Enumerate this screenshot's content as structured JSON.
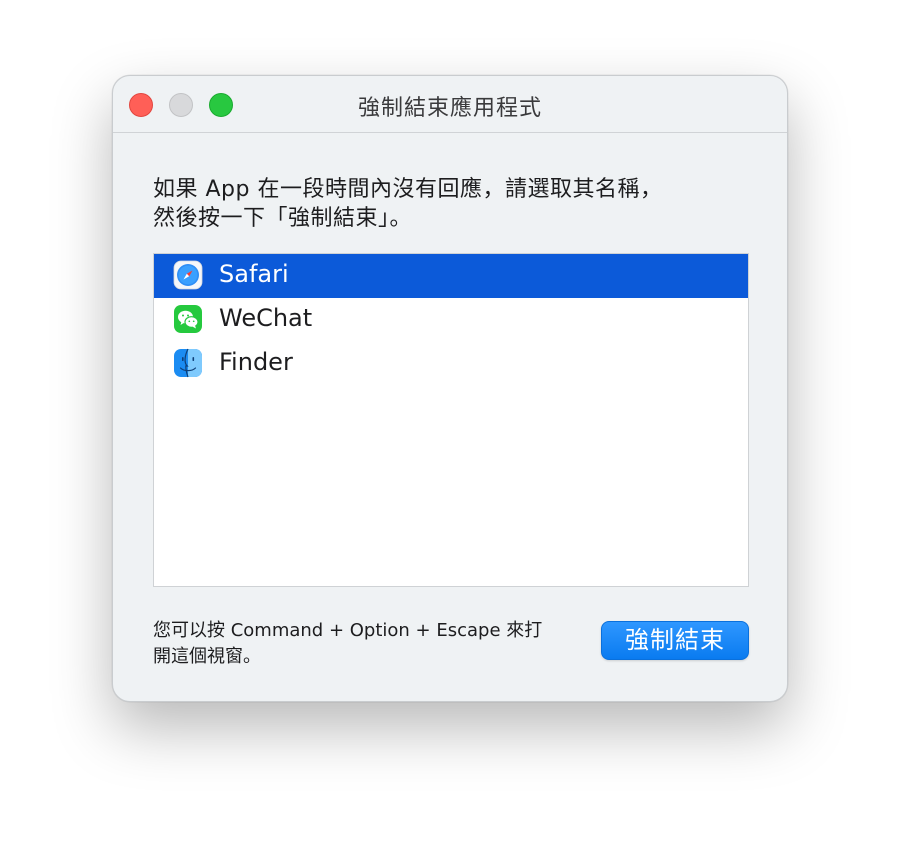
{
  "window": {
    "title": "強制結束應用程式"
  },
  "instructions": {
    "line1": "如果 App 在一段時間內沒有回應，請選取其名稱，",
    "line2": "然後按一下「強制結束」。"
  },
  "apps": [
    {
      "name": "Safari",
      "icon": "safari-icon",
      "selected": true
    },
    {
      "name": "WeChat",
      "icon": "wechat-icon",
      "selected": false
    },
    {
      "name": "Finder",
      "icon": "finder-icon",
      "selected": false
    }
  ],
  "hint": {
    "line1": "您可以按 Command + Option + Escape 來打",
    "line2": "開這個視窗。"
  },
  "button": {
    "label": "強制結束"
  },
  "colors": {
    "selection": "#0c5ad9",
    "button": "#0a7bf0",
    "close": "#ff5f57",
    "zoom": "#28c840"
  }
}
